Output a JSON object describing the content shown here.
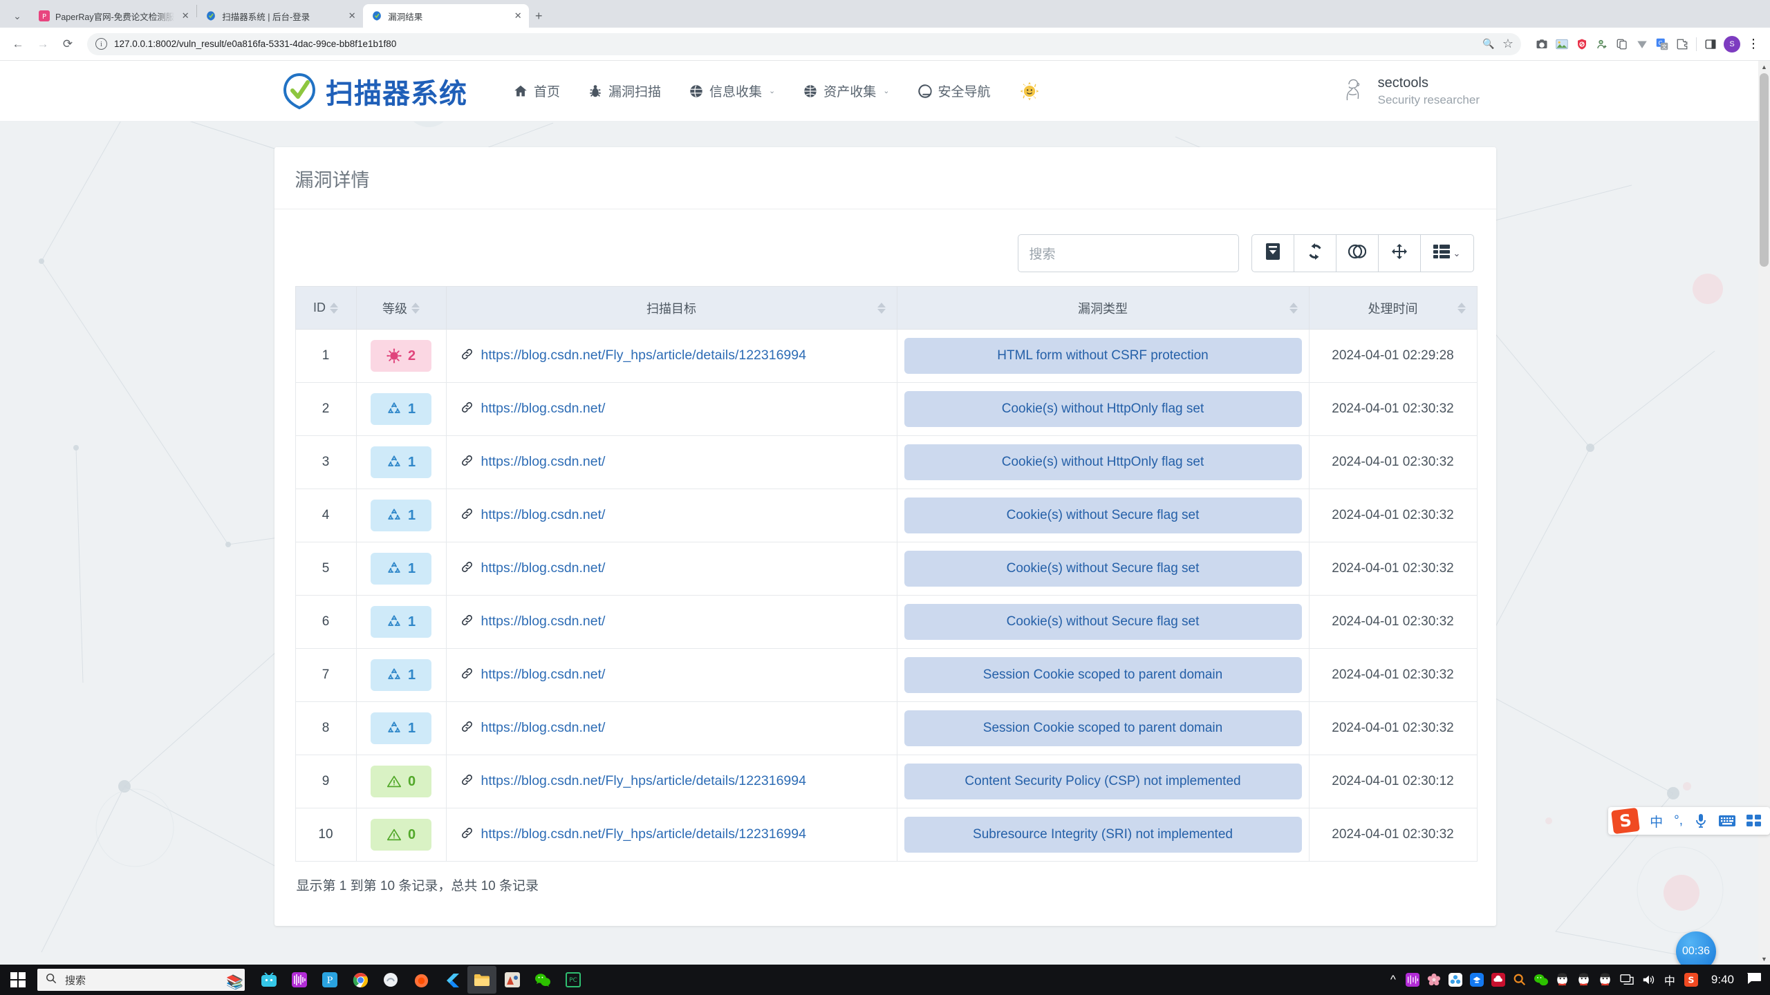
{
  "browser": {
    "tabs": [
      {
        "title": "PaperRay官网-免费论文检测服",
        "favicon": "paperray-icon",
        "active": false
      },
      {
        "title": "扫描器系统 | 后台-登录",
        "favicon": "scanner-icon",
        "active": false
      },
      {
        "title": "漏洞结果",
        "favicon": "scanner-icon",
        "active": true
      }
    ],
    "new_tab_label": "+",
    "tab_close_label": "✕",
    "tab_list_icon": "chevron-down-icon",
    "back_icon": "←",
    "forward_icon": "→",
    "reload_icon": "⟳",
    "url": "127.0.0.1:8002/vuln_result/e0a816fa-5331-4dac-99ce-bb8f1e1b1f80",
    "site_info_icon": "info-circle-icon",
    "zoom_icon": "🔍",
    "bookmark_icon": "☆",
    "profile_initial": "S",
    "menu_icon": "⋮",
    "extensions": [
      "camera-icon",
      "image-icon",
      "shield-icon",
      "person-add-icon",
      "copy-icon",
      "v-icon",
      "translate-icon",
      "extensions-icon",
      "sidepanel-icon"
    ]
  },
  "site": {
    "brand_name": "扫描器系统",
    "brand_logo": "scanner-check-logo",
    "nav": [
      {
        "label": "首页",
        "icon": "home-icon",
        "caret": ""
      },
      {
        "label": "漏洞扫描",
        "icon": "bug-icon",
        "caret": ""
      },
      {
        "label": "信息收集",
        "icon": "globe-icon",
        "caret": "⌄"
      },
      {
        "label": "资产收集",
        "icon": "network-globe-icon",
        "caret": "⌄"
      },
      {
        "label": "安全导航",
        "icon": "compass-icon",
        "caret": ""
      }
    ],
    "gear_icon": "sun-emoji-icon",
    "user": {
      "avatar_icon": "user-sketch-avatar",
      "name": "sectools",
      "role": "Security researcher"
    }
  },
  "card": {
    "title": "漏洞详情",
    "search": {
      "placeholder": "搜索",
      "value": ""
    },
    "toolbar_buttons": [
      {
        "name": "export-button",
        "icon": "export-down-icon"
      },
      {
        "name": "refresh-button",
        "icon": "refresh-icon"
      },
      {
        "name": "toggle-view-button",
        "icon": "contrast-toggle-icon"
      },
      {
        "name": "fullscreen-button",
        "icon": "arrows-move-icon"
      },
      {
        "name": "columns-button",
        "icon": "columns-list-icon",
        "caret": "⌄"
      }
    ],
    "columns": [
      {
        "key": "id",
        "label": "ID",
        "sortable": true
      },
      {
        "key": "level",
        "label": "等级",
        "sortable": true
      },
      {
        "key": "target",
        "label": "扫描目标",
        "sortable": true
      },
      {
        "key": "type",
        "label": "漏洞类型",
        "sortable": true
      },
      {
        "key": "time",
        "label": "处理时间",
        "sortable": true
      }
    ],
    "rows": [
      {
        "id": "1",
        "level": "2",
        "level_class": "lvl-2",
        "level_icon": "virus-icon",
        "target": "https://blog.csdn.net/Fly_hps/article/details/122316994",
        "type": "HTML form without CSRF protection",
        "time": "2024-04-01 02:29:28"
      },
      {
        "id": "2",
        "level": "1",
        "level_class": "lvl-1",
        "level_icon": "radiation-icon",
        "target": "https://blog.csdn.net/",
        "type": "Cookie(s) without HttpOnly flag set",
        "time": "2024-04-01 02:30:32"
      },
      {
        "id": "3",
        "level": "1",
        "level_class": "lvl-1",
        "level_icon": "radiation-icon",
        "target": "https://blog.csdn.net/",
        "type": "Cookie(s) without HttpOnly flag set",
        "time": "2024-04-01 02:30:32"
      },
      {
        "id": "4",
        "level": "1",
        "level_class": "lvl-1",
        "level_icon": "radiation-icon",
        "target": "https://blog.csdn.net/",
        "type": "Cookie(s) without Secure flag set",
        "time": "2024-04-01 02:30:32"
      },
      {
        "id": "5",
        "level": "1",
        "level_class": "lvl-1",
        "level_icon": "radiation-icon",
        "target": "https://blog.csdn.net/",
        "type": "Cookie(s) without Secure flag set",
        "time": "2024-04-01 02:30:32"
      },
      {
        "id": "6",
        "level": "1",
        "level_class": "lvl-1",
        "level_icon": "radiation-icon",
        "target": "https://blog.csdn.net/",
        "type": "Cookie(s) without Secure flag set",
        "time": "2024-04-01 02:30:32"
      },
      {
        "id": "7",
        "level": "1",
        "level_class": "lvl-1",
        "level_icon": "radiation-icon",
        "target": "https://blog.csdn.net/",
        "type": "Session Cookie scoped to parent domain",
        "time": "2024-04-01 02:30:32"
      },
      {
        "id": "8",
        "level": "1",
        "level_class": "lvl-1",
        "level_icon": "radiation-icon",
        "target": "https://blog.csdn.net/",
        "type": "Session Cookie scoped to parent domain",
        "time": "2024-04-01 02:30:32"
      },
      {
        "id": "9",
        "level": "0",
        "level_class": "lvl-0",
        "level_icon": "warning-triangle-icon",
        "target": "https://blog.csdn.net/Fly_hps/article/details/122316994",
        "type": "Content Security Policy (CSP) not implemented",
        "time": "2024-04-01 02:30:12"
      },
      {
        "id": "10",
        "level": "0",
        "level_class": "lvl-0",
        "level_icon": "warning-triangle-icon",
        "target": "https://blog.csdn.net/Fly_hps/article/details/122316994",
        "type": "Subresource Integrity (SRI) not implemented",
        "time": "2024-04-01 02:30:32"
      }
    ],
    "footer_info": "显示第 1 到第 10 条记录，总共 10 条记录"
  },
  "overlays": {
    "ime": {
      "logo": "S",
      "items": [
        "中",
        "°,",
        "mic-icon",
        "keyboard-icon",
        "apps-grid-icon"
      ]
    },
    "timer_badge": "00:36"
  },
  "taskbar": {
    "start_icon": "windows-logo-icon",
    "search_placeholder": "搜索",
    "search_icon": "search-icon",
    "apps": [
      "bilibili-icon",
      "netease-music-icon",
      "pdf-icon",
      "chrome-icon",
      "app-white-icon",
      "firefox-icon",
      "flutter-icon",
      "file-explorer-icon",
      "app-red-icon",
      "wechat-icon",
      "pc-manager-icon"
    ],
    "tray_overflow_icon": "^",
    "tray": [
      "netease-icon",
      "flower-icon",
      "blue-circles-icon",
      "tim-icon",
      "cloud-icon",
      "search-orange-icon",
      "wechat-icon",
      "qq-icon",
      "qq-icon",
      "qq-icon",
      "display-icon",
      "volume-icon",
      "ime-cn-icon",
      "sogou-icon"
    ],
    "clock": "9:40",
    "notification_icon": "notification-icon"
  }
}
